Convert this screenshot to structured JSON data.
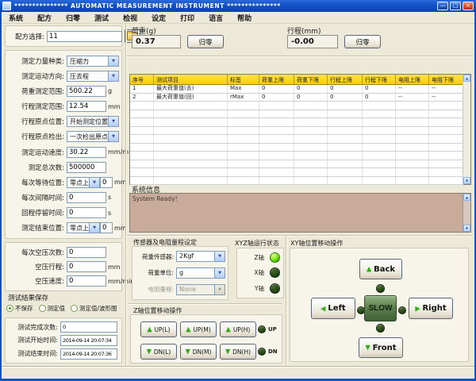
{
  "window": {
    "title": "***************  AUTOMATIC MEASUREMENT INSTRUMENT  ***************"
  },
  "icons": {
    "chevron_down": "▼",
    "arrow_up": "▲",
    "arrow_down": "▼",
    "arrow_left": "◀",
    "arrow_right": "▶",
    "scroll_up": "▲",
    "scroll_down": "▼",
    "minimize": "—",
    "maximize": "□",
    "close": "×"
  },
  "menu": {
    "items": [
      "系统",
      "配方",
      "归零",
      "测试",
      "检视",
      "设定",
      "打印",
      "语言",
      "帮助"
    ]
  },
  "left": {
    "recipe": {
      "label": "配方选择:",
      "value": "11"
    },
    "params": [
      {
        "label": "测定力量种类:",
        "value": "压缩力"
      },
      {
        "label": "测定运动方向:",
        "value": "压去程"
      },
      {
        "label": "荷重测定范围:",
        "value": "500.22",
        "unit": "g"
      },
      {
        "label": "行程测定范围:",
        "value": "12.54",
        "unit": "mm"
      },
      {
        "label": "行程原点位置:",
        "value": "开始测定位置"
      },
      {
        "label": "行程原点检出:",
        "value": "一次检出原点"
      },
      {
        "label": "测定运动速度:",
        "value": "30.22",
        "unit": "mm/min"
      },
      {
        "label": "测定总次数:",
        "value": "500000",
        "unit": ""
      },
      {
        "label": "每次等待位置:",
        "value": "零点上方",
        "value2": "0",
        "unit": "mm"
      },
      {
        "label": "每次间隔时间:",
        "value": "0",
        "unit": "s"
      },
      {
        "label": "回程停留时间:",
        "value": "0",
        "unit": "s"
      },
      {
        "label": "测定结束位置:",
        "value": "零点上方",
        "value2": "0",
        "unit": "mm"
      }
    ],
    "air": [
      {
        "label": "每次空压次数:",
        "value": "0",
        "unit": ""
      },
      {
        "label": "空压行程:",
        "value": "0",
        "unit": "mm"
      },
      {
        "label": "空压速度:",
        "value": "0",
        "unit": "mm/min"
      }
    ],
    "save": {
      "title": "测试结果保存",
      "options": [
        {
          "label": "不保存",
          "selected": true
        },
        {
          "label": "测定值",
          "selected": false
        },
        {
          "label": "测定值/波形图",
          "selected": false
        }
      ]
    },
    "times": [
      {
        "label": "测试完成次数:",
        "value": "0"
      },
      {
        "label": "测试开始时间:",
        "value": "2014-09-14 20:07:34"
      },
      {
        "label": "测试结束时间:",
        "value": "2014-09-14 20:07:36"
      }
    ]
  },
  "readouts": {
    "load": {
      "label": "荷重(g)",
      "value": "0.37",
      "zero": "归零"
    },
    "stroke": {
      "label": "行程(mm)",
      "value": "-0.00",
      "zero": "归零"
    }
  },
  "table": {
    "headers": [
      "序号",
      "测试项目",
      "标签",
      "荷重上限",
      "荷重下限",
      "行程上限",
      "行程下限",
      "电阻上限",
      "电阻下限"
    ],
    "rows": [
      [
        "1",
        "最大荷重值(去)",
        "Max",
        "0",
        "0",
        "0",
        "0",
        "--",
        "--"
      ],
      [
        "2",
        "最大荷重值(回)",
        "rMax",
        "0",
        "0",
        "0",
        "0",
        "--",
        "--"
      ],
      [
        "",
        "",
        "",
        "",
        "",
        "",
        "",
        "",
        ""
      ],
      [
        "",
        "",
        "",
        "",
        "",
        "",
        "",
        "",
        ""
      ],
      [
        "",
        "",
        "",
        "",
        "",
        "",
        "",
        "",
        ""
      ],
      [
        "",
        "",
        "",
        "",
        "",
        "",
        "",
        "",
        ""
      ],
      [
        "",
        "",
        "",
        "",
        "",
        "",
        "",
        "",
        ""
      ],
      [
        "",
        "",
        "",
        "",
        "",
        "",
        "",
        "",
        ""
      ],
      [
        "",
        "",
        "",
        "",
        "",
        "",
        "",
        "",
        ""
      ],
      [
        "",
        "",
        "",
        "",
        "",
        "",
        "",
        "",
        ""
      ],
      [
        "",
        "",
        "",
        "",
        "",
        "",
        "",
        "",
        ""
      ],
      [
        "",
        "",
        "",
        "",
        "",
        "",
        "",
        "",
        ""
      ]
    ]
  },
  "sysmsg": {
    "label": "系统信息",
    "text": "System Ready!"
  },
  "sensor": {
    "title": "传感器及电阻量程设定",
    "rows": [
      {
        "label": "荷重传感器:",
        "value": "2Kgf"
      },
      {
        "label": "荷重单位:",
        "value": "g"
      },
      {
        "label": "电阻量程:",
        "value": "None",
        "disabled": true
      }
    ]
  },
  "xyz": {
    "title": "XYZ轴运行状态",
    "leds": [
      {
        "label": "Z轴",
        "on": true
      },
      {
        "label": "X轴",
        "on": false
      },
      {
        "label": "Y轴",
        "on": false
      }
    ]
  },
  "zaxis": {
    "title": "Z轴位置移动操作",
    "up_buttons": [
      "UP(L)",
      "UP(M)",
      "UP(H)"
    ],
    "down_buttons": [
      "DN(L)",
      "DN(M)",
      "DN(H)"
    ],
    "up_led": "UP",
    "down_led": "DN"
  },
  "xy": {
    "title": "XY轴位置移动操作",
    "back": "Back",
    "left": "Left",
    "slow": "SLOW",
    "right": "Right",
    "front": "Front"
  },
  "colors": {
    "titlebar_blue": "#0e54c9",
    "table_header_yellow": "#fccf05",
    "message_bg": "#c9ab9c",
    "led_on_green": "#6fe000",
    "led_off_green": "#1d3a12",
    "arrow_green": "#2fae12"
  }
}
